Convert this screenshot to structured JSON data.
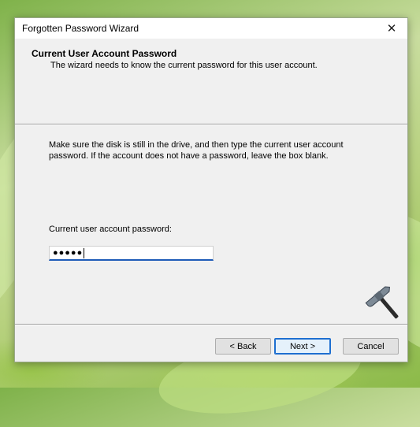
{
  "window": {
    "title": "Forgotten Password Wizard"
  },
  "header": {
    "title": "Current User Account Password",
    "subtitle": "The wizard needs to know the current password for this user account."
  },
  "content": {
    "instructions": "Make sure the disk is still in the drive, and then type the current user account password. If the account does not have a password, leave the box blank.",
    "password_label": "Current user account password:",
    "password_value_masked": "●●●●●"
  },
  "buttons": {
    "back": "< Back",
    "next": "Next >",
    "cancel": "Cancel"
  },
  "icons": {
    "close": "close-icon",
    "watermark": "hammer-icon"
  }
}
